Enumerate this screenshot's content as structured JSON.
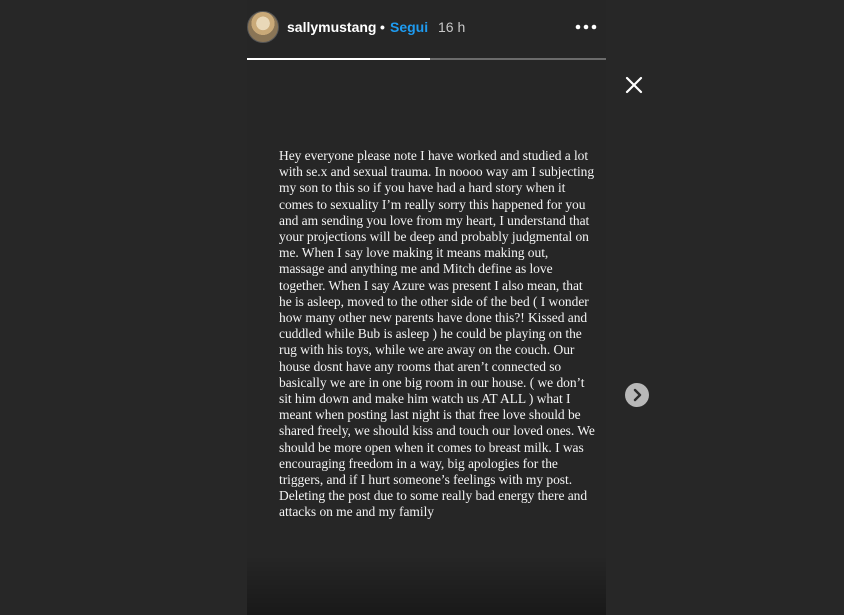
{
  "header": {
    "username": "sallymustang",
    "separator": "•",
    "follow_label": "Segui",
    "time": "16 h",
    "more_icon": "more-horizontal-icon"
  },
  "progress": {
    "segments": 2,
    "current": 1,
    "fill": 1.0
  },
  "story": {
    "text": "Hey everyone please note I have worked and studied a lot with se.x and sexual trauma. In noooo way am I subjecting my son to this so if you have had a hard story when it comes to sexuality I’m really sorry this happened for you and am sending you love from my heart, I understand that your projections will be deep and probably judgmental on me. When I say love making it means making out, massage and anything me and Mitch define as love together. When I say Azure was present I also mean, that he is asleep, moved to the other side of the bed ( I wonder how many other new parents have done this?! Kissed and cuddled while Bub is asleep ) he could be playing on the rug with his toys, while we are away on the couch. Our house dosnt have any rooms that aren’t connected so basically we are in one big room in our house. ( we don’t sit him down and make him watch us AT ALL ) what I meant when posting last night is that free love should be shared freely, we should kiss and touch our loved ones. We should be more open when it comes to breast milk. I was encouraging freedom in a way, big apologies for the triggers, and if I hurt someone’s feelings with my post. Deleting the post due to some really bad energy there and attacks on me and my family"
  },
  "icons": {
    "close": "close-icon",
    "next": "chevron-right-icon"
  },
  "colors": {
    "background": "#272727",
    "follow": "#1e9bf0",
    "text": "#f3f3f3"
  }
}
